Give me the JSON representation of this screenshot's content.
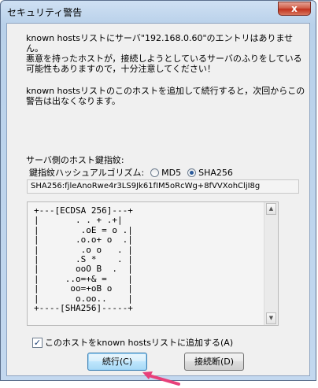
{
  "window": {
    "title": "セキュリティ警告",
    "close_glyph": "x"
  },
  "message": {
    "warning": "known hostsリストにサーバ\"192.168.0.60\"のエントリはありません。\n悪意を持ったホストが，接続しようとしているサーバのふりをしている\n可能性もありますので，十分注意してください！",
    "hint": "known hostsリストのこのホストを追加して続行すると，次回からこの\n警告は出なくなります。"
  },
  "fingerprint": {
    "label": "サーバ側のホスト鍵指紋:",
    "algo_label": "鍵指紋ハッシュアルゴリズム:",
    "options": [
      {
        "label": "MD5",
        "checked": false
      },
      {
        "label": "SHA256",
        "checked": true
      }
    ],
    "value": "SHA256:fjleAnoRwe4r3LS9Jk61fIM5oRcWg+8fVVXohCljI8g",
    "randomart": "+---[ECDSA 256]---+\n|       . . + .+|\n|        .oE = o .|\n|       .o.o+ o  .|\n|        .o o   . |\n|       .S *    . |\n|       ooO B  .  |\n|     ..o=+& =    |\n|      oo=+oB o   |\n|       o.oo..    |\n+----[SHA256]-----+"
  },
  "add_to_known_hosts": {
    "label": "このホストをknown hostsリストに追加する(A)",
    "checked": true
  },
  "buttons": {
    "continue": "続行(C)",
    "disconnect": "接続断(D)"
  },
  "colors": {
    "annotation_arrow": "#e8407a"
  }
}
